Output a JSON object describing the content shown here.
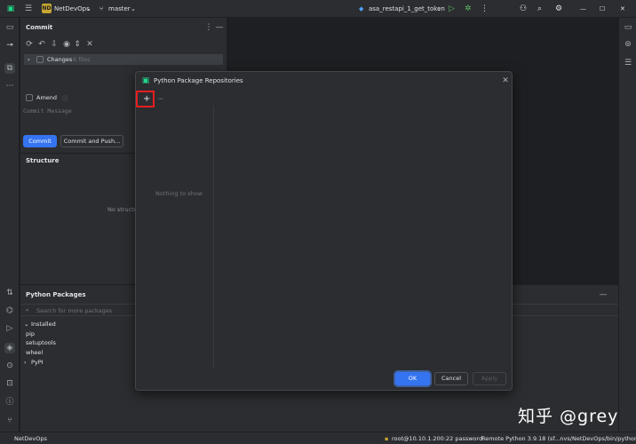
{
  "titlebar": {
    "project_badge": "ND",
    "project_name": "NetDevOps",
    "branch": "master",
    "run_config": "asa_restapi_1_get_token"
  },
  "commit_panel": {
    "title": "Commit",
    "changes_label": "Changes",
    "changes_count": "6 files",
    "amend_label": "Amend",
    "message_placeholder": "Commit Message",
    "commit_button": "Commit",
    "commit_push_button": "Commit and Push..."
  },
  "structure_panel": {
    "title": "Structure",
    "empty_text": "No structu"
  },
  "packages_panel": {
    "title": "Python Packages",
    "search_placeholder": "Search for more packages",
    "installed_label": "Installed",
    "packages": [
      "pip",
      "setuptools",
      "wheel"
    ],
    "pypi_label": "PyPI"
  },
  "dialog": {
    "title": "Python Package Repositories",
    "add_glyph": "+",
    "remove_glyph": "−",
    "empty_text": "Nothing to show",
    "ok_button": "OK",
    "cancel_button": "Cancel",
    "apply_button": "Apply"
  },
  "statusbar": {
    "project": "NetDevOps",
    "connection": "root@10.10.1.200:22 password",
    "interpreter": "Remote Python 3.9.18 (sf...nvs/NetDevOps/bin/python)"
  },
  "watermark": "知乎 @grey",
  "colors": {
    "accent": "#3574f0",
    "highlight": "#e81e1e",
    "project_badge": "#c7a632"
  }
}
